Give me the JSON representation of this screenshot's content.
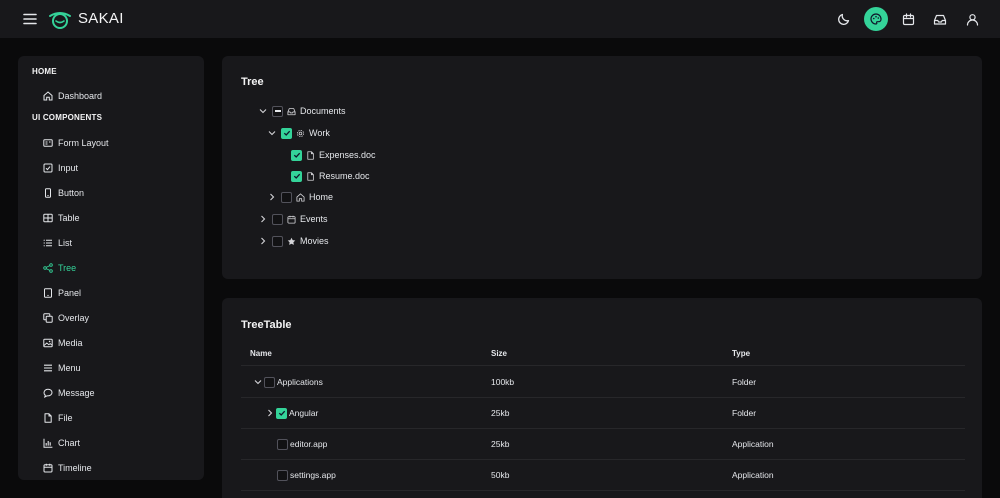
{
  "topbar": {
    "brand": "SAKAI",
    "icons": [
      "moon-icon",
      "palette-icon",
      "calendar-icon",
      "inbox-icon",
      "user-icon"
    ],
    "accent": "#34d399"
  },
  "sidebar": {
    "sections": [
      {
        "title": "HOME",
        "items": [
          {
            "label": "Dashboard",
            "icon": "home-icon"
          }
        ]
      },
      {
        "title": "UI COMPONENTS",
        "items": [
          {
            "label": "Form Layout",
            "icon": "id-card-icon"
          },
          {
            "label": "Input",
            "icon": "check-square-icon"
          },
          {
            "label": "Button",
            "icon": "mobile-icon"
          },
          {
            "label": "Table",
            "icon": "table-icon"
          },
          {
            "label": "List",
            "icon": "list-icon"
          },
          {
            "label": "Tree",
            "icon": "share-icon",
            "active": true
          },
          {
            "label": "Panel",
            "icon": "tablet-icon"
          },
          {
            "label": "Overlay",
            "icon": "clone-icon"
          },
          {
            "label": "Media",
            "icon": "image-icon"
          },
          {
            "label": "Menu",
            "icon": "bars-icon"
          },
          {
            "label": "Message",
            "icon": "comment-icon"
          },
          {
            "label": "File",
            "icon": "file-icon"
          },
          {
            "label": "Chart",
            "icon": "chart-bar-icon"
          },
          {
            "label": "Timeline",
            "icon": "calendar-icon"
          }
        ]
      }
    ]
  },
  "tree": {
    "title": "Tree",
    "nodes": [
      {
        "label": "Documents",
        "level": 0,
        "expanded": true,
        "state": "partial",
        "icon": "inbox-icon"
      },
      {
        "label": "Work",
        "level": 1,
        "expanded": true,
        "state": "checked",
        "icon": "cog-icon"
      },
      {
        "label": "Expenses.doc",
        "level": 2,
        "leaf": true,
        "state": "checked",
        "icon": "file-icon"
      },
      {
        "label": "Resume.doc",
        "level": 2,
        "leaf": true,
        "state": "checked",
        "icon": "file-icon"
      },
      {
        "label": "Home",
        "level": 1,
        "expanded": false,
        "state": "unchecked",
        "icon": "home-icon"
      },
      {
        "label": "Events",
        "level": 0,
        "expanded": false,
        "state": "unchecked",
        "icon": "calendar-icon"
      },
      {
        "label": "Movies",
        "level": 0,
        "expanded": false,
        "state": "unchecked",
        "icon": "star-icon"
      }
    ]
  },
  "treetable": {
    "title": "TreeTable",
    "columns": [
      "Name",
      "Size",
      "Type"
    ],
    "rows": [
      {
        "name": "Applications",
        "size": "100kb",
        "type": "Folder",
        "level": 0,
        "toggle": "expanded",
        "state": "unchecked"
      },
      {
        "name": "Angular",
        "size": "25kb",
        "type": "Folder",
        "level": 1,
        "toggle": "collapsed",
        "state": "checked"
      },
      {
        "name": "editor.app",
        "size": "25kb",
        "type": "Application",
        "level": 1,
        "toggle": "none",
        "state": "unchecked"
      },
      {
        "name": "settings.app",
        "size": "50kb",
        "type": "Application",
        "level": 1,
        "toggle": "none",
        "state": "unchecked"
      }
    ]
  }
}
